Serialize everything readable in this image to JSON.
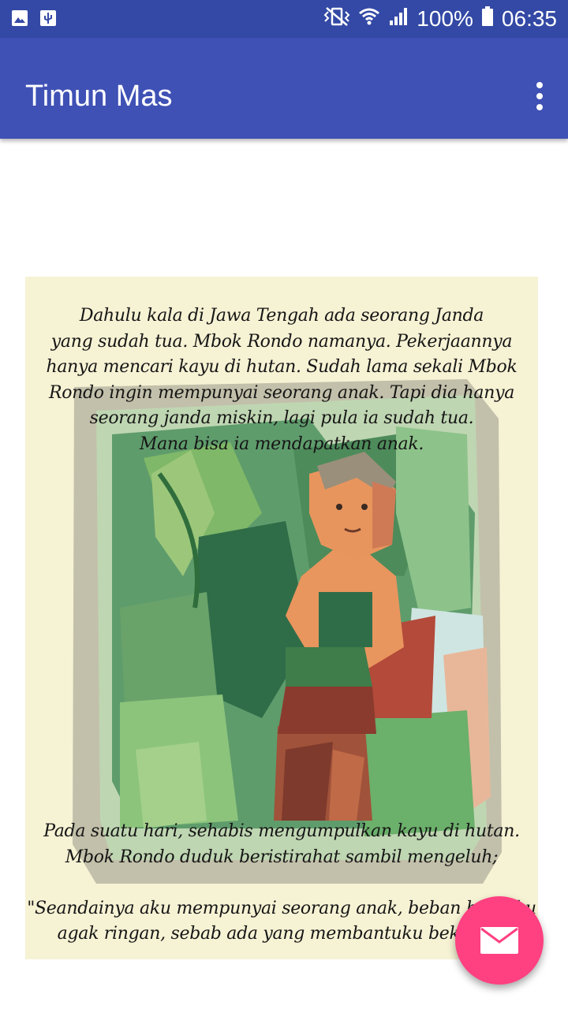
{
  "status_bar": {
    "battery": "100%",
    "time": "06:35",
    "icons": [
      "image-icon",
      "usb-icon",
      "vibrate-icon",
      "wifi-icon",
      "signal-icon",
      "battery-icon"
    ]
  },
  "app_bar": {
    "title": "Timun Mas",
    "overflow_icon": "more-vert-icon"
  },
  "story": {
    "paragraph_1": "Dahulu kala di Jawa Tengah ada seorang Janda\nyang sudah tua. Mbok Rondo namanya. Pekerjaannya\nhanya mencari kayu di hutan. Sudah lama sekali Mbok\nRondo ingin mempunyai seorang anak. Tapi dia hanya\nseorang janda miskin, lagi pula ia sudah tua.\nMana bisa ia mendapatkan anak.",
    "paragraph_2": "Pada suatu hari, sehabis mengumpulkan kayu di hutan.\nMbok Rondo duduk beristirahat sambil mengeluh;\n\n\"Seandainya aku mempunyai seorang anak, beban hidupku\nagak ringan, sebab ada yang membantuku bekerja.\""
  },
  "fab": {
    "icon": "email-icon",
    "color": "#ff4081"
  },
  "colors": {
    "app_bar": "#3f51b5",
    "status_bar": "#3349a5",
    "page_background": "#f6f2d4"
  }
}
